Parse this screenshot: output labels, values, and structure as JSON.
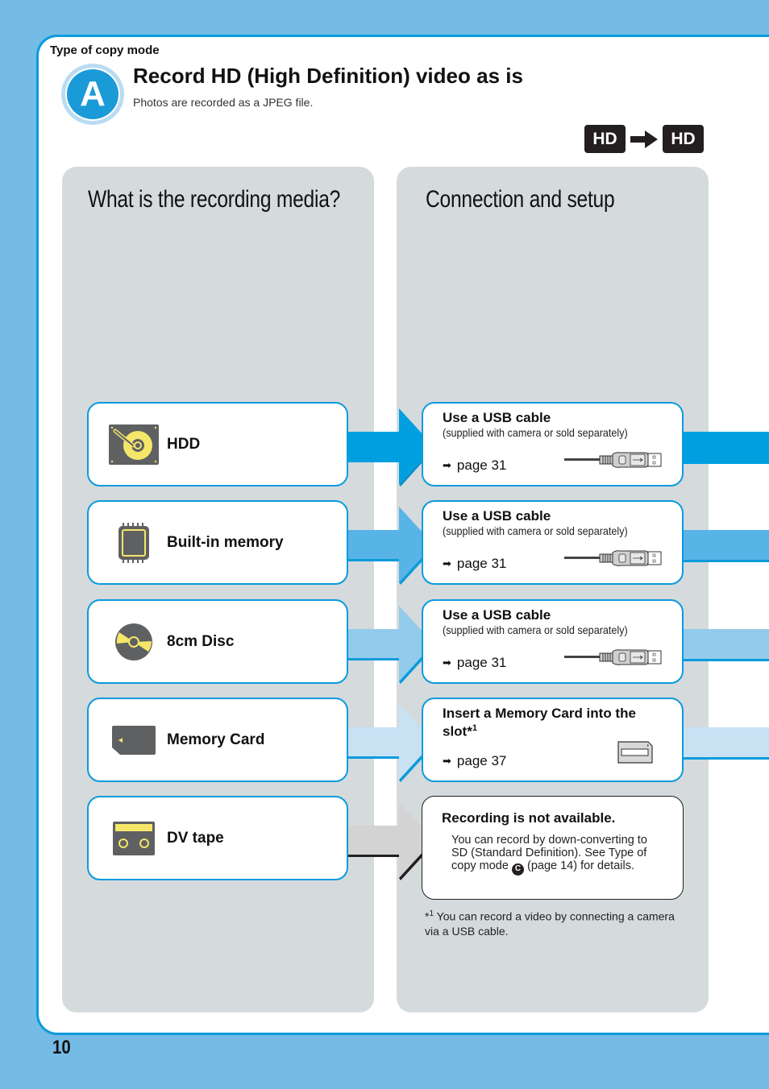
{
  "header": {
    "section_label": "Type of copy mode",
    "mode_letter": "A",
    "title": "Record HD (High Definition) video as is",
    "subtitle": "Photos are recorded as a JPEG file.",
    "conversion": {
      "from": "HD",
      "to": "HD"
    }
  },
  "panels": {
    "left_title": "What is the recording media?",
    "right_title": "Connection and setup"
  },
  "colors": {
    "page_bg": "#74bbe6",
    "frame_border": "#0a9bdc",
    "panel_bg": "#d5dadd",
    "arrow_hdd": "#00a0e0",
    "arrow_builtin": "#58b4e6",
    "arrow_disc": "#93cbec",
    "arrow_card": "#c8e2f4",
    "arrow_tape": "#d3d3d3"
  },
  "rows": [
    {
      "media": {
        "label": "HDD",
        "icon": "hard-disk-icon"
      },
      "connection": {
        "title": "Use a USB cable",
        "note": "(supplied with camera or sold separately)",
        "page": "page 31",
        "illustration": "usb-cable-icon"
      }
    },
    {
      "media": {
        "label": "Built-in memory",
        "icon": "memory-chip-icon"
      },
      "connection": {
        "title": "Use a USB cable",
        "note": "(supplied with camera or sold separately)",
        "page": "page 31",
        "illustration": "usb-cable-icon"
      }
    },
    {
      "media": {
        "label": "8cm Disc",
        "icon": "disc-icon"
      },
      "connection": {
        "title": "Use a USB cable",
        "note": "(supplied with camera or sold separately)",
        "page": "page 31",
        "illustration": "usb-cable-icon"
      }
    },
    {
      "media": {
        "label": "Memory Card",
        "icon": "memory-card-icon"
      },
      "connection": {
        "title_line1": "Insert a Memory Card into the",
        "title_line2": "slot*",
        "footnote_ref": "1",
        "page": "page 37",
        "illustration": "memory-card-slot-icon"
      }
    },
    {
      "media": {
        "label": "DV tape",
        "icon": "dv-tape-icon"
      },
      "connection": {
        "title": "Recording is not available.",
        "body_before": "You can record by down-converting to SD (Standard Definition). See Type of copy mode",
        "mode_ref": "C",
        "body_after": "(page 14) for details."
      }
    }
  ],
  "footnote": {
    "marker": "*",
    "ref": "1",
    "text": "You can record a video by connecting a camera via a USB cable."
  },
  "page_number": "10"
}
